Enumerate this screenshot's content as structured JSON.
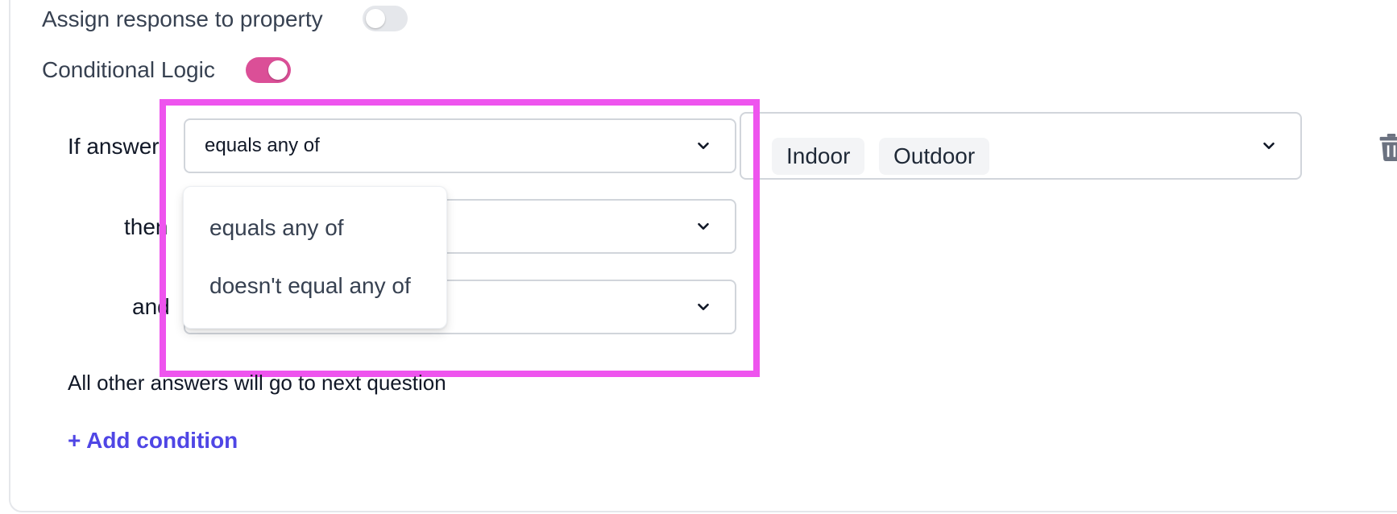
{
  "settings": {
    "assign_response_label": "Assign response to property",
    "assign_response_enabled": false,
    "conditional_logic_label": "Conditional Logic",
    "conditional_logic_enabled": true
  },
  "condition": {
    "if_label": "If answer",
    "operator_value": "equals any of",
    "answers": [
      "Indoor",
      "Outdoor"
    ],
    "then_label": "then",
    "and_label": "and"
  },
  "operator_menu": {
    "options": [
      "equals any of",
      "doesn't equal any of"
    ]
  },
  "footer": {
    "fallback_text": "All other answers will go to next question",
    "add_condition_label": "+ Add condition"
  },
  "colors": {
    "accent_toggle": "#db4f97",
    "highlight": "#ee54ee",
    "link": "#4f46e5"
  },
  "icons": {
    "chevron": "chevron-down-icon",
    "delete": "trash-icon"
  }
}
